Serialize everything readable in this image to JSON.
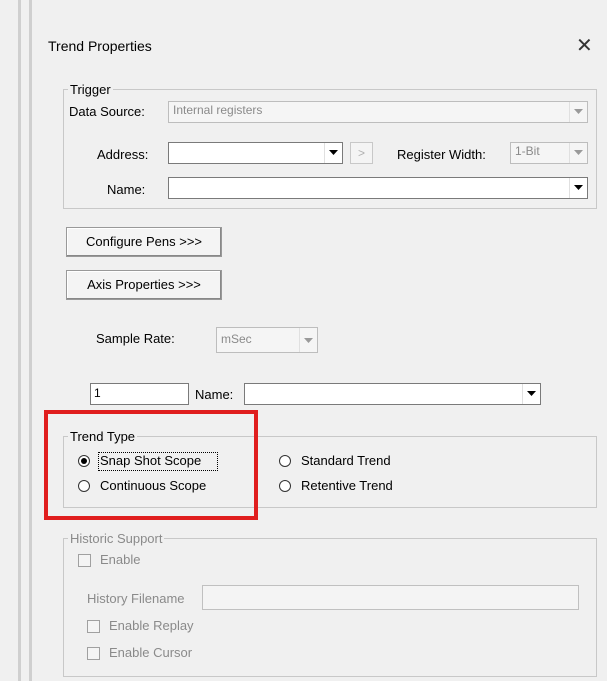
{
  "window": {
    "title": "Trend Properties",
    "close_glyph": "✕"
  },
  "trigger": {
    "legend": "Trigger",
    "data_source_label": "Data Source:",
    "data_source_value": "Internal registers",
    "address_label": "Address:",
    "address_value": "",
    "next_glyph": ">",
    "register_width_label": "Register Width:",
    "register_width_value": "1-Bit",
    "name_label": "Name:",
    "name_value": ""
  },
  "buttons": {
    "configure_pens": "Configure Pens >>>",
    "axis_properties": "Axis Properties >>>"
  },
  "sample_rate": {
    "label": "Sample Rate:",
    "value": "mSec"
  },
  "pen_row": {
    "number_value": "1",
    "name_label": "Name:",
    "name_value": ""
  },
  "trend_type": {
    "legend": "Trend Type",
    "options": [
      {
        "label": "Snap Shot Scope",
        "selected": true
      },
      {
        "label": "Continuous Scope",
        "selected": false
      },
      {
        "label": "Standard Trend",
        "selected": false
      },
      {
        "label": "Retentive Trend",
        "selected": false
      }
    ],
    "highlight_color": "#e01e1e"
  },
  "historic_support": {
    "legend": "Historic Support",
    "enable_label": "Enable",
    "history_filename_label": "History Filename",
    "history_filename_value": "",
    "enable_replay_label": "Enable Replay",
    "enable_cursor_label": "Enable Cursor"
  }
}
